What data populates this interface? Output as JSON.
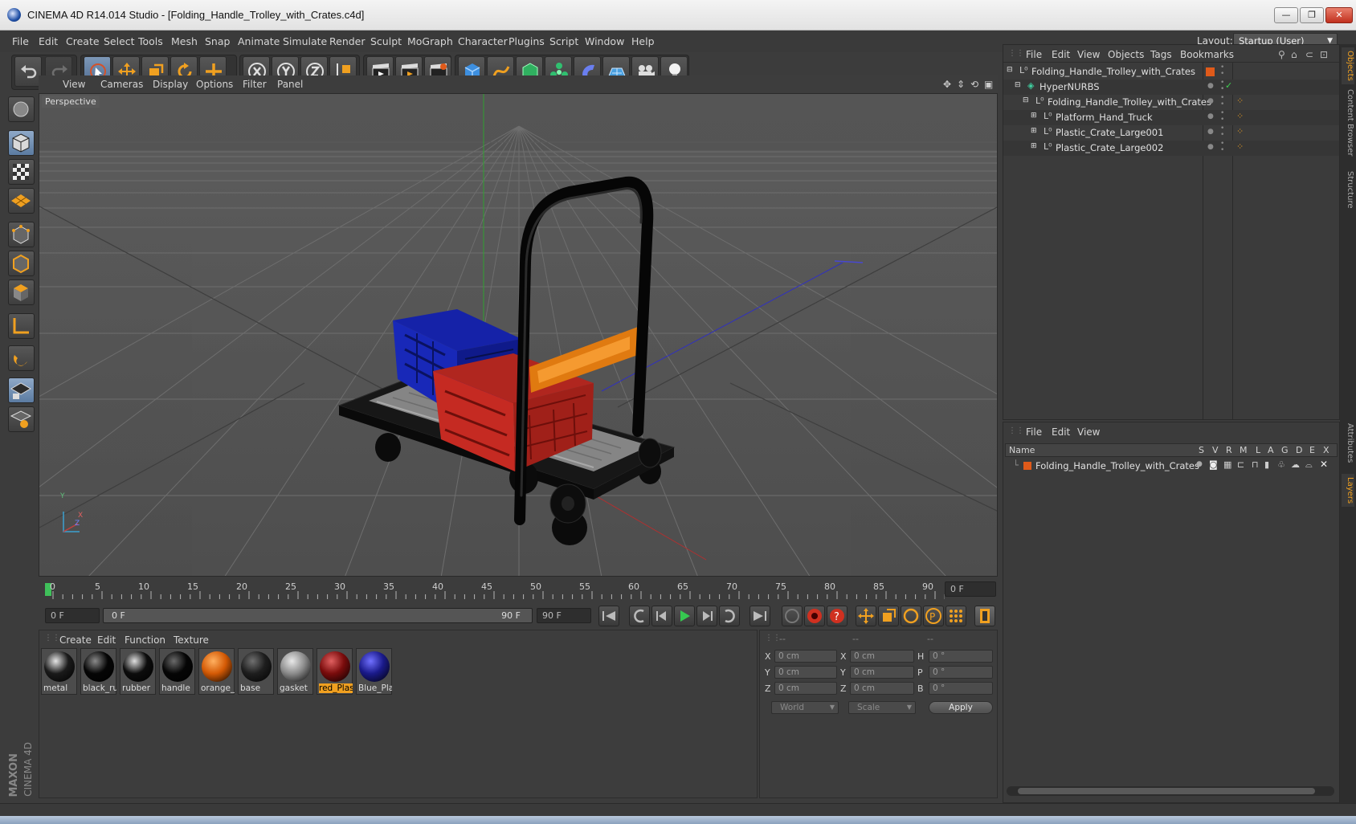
{
  "window": {
    "title": "CINEMA 4D R14.014 Studio - [Folding_Handle_Trolley_with_Crates.c4d]",
    "minimize": "—",
    "restore": "❐",
    "close": "✕"
  },
  "menubar": {
    "items": [
      "File",
      "Edit",
      "Create",
      "Select",
      "Tools",
      "Mesh",
      "Snap",
      "Animate",
      "Simulate",
      "Render",
      "Sculpt",
      "MoGraph",
      "Character",
      "Plugins",
      "Script",
      "Window",
      "Help"
    ],
    "layout_label": "Layout:",
    "layout_value": "Startup (User)"
  },
  "viewport": {
    "menu": [
      "View",
      "Cameras",
      "Display",
      "Options",
      "Filter",
      "Panel"
    ],
    "label": "Perspective",
    "axis_y": "Y",
    "axis_x": "X",
    "axis_z": "Z"
  },
  "timeline": {
    "ticks": [
      "0",
      "5",
      "10",
      "15",
      "20",
      "25",
      "30",
      "35",
      "40",
      "45",
      "50",
      "55",
      "60",
      "65",
      "70",
      "75",
      "80",
      "85",
      "90"
    ],
    "current_frame": "0 F"
  },
  "transport": {
    "start_field": "0 F",
    "range_start": "0 F",
    "range_end": "90 F",
    "end_field": "90 F"
  },
  "materials": {
    "menu": [
      "Create",
      "Edit",
      "Function",
      "Texture"
    ],
    "items": [
      {
        "label": "metal",
        "color": "#1a1a1a",
        "hi": "#e6e6e6"
      },
      {
        "label": "black_ru",
        "color": "#050505",
        "hi": "#8a8a8a"
      },
      {
        "label": "rubber",
        "color": "#0c0c0c",
        "hi": "#e0e0e0"
      },
      {
        "label": "handle",
        "color": "#050505",
        "hi": "#6a6a6a"
      },
      {
        "label": "orange_",
        "color": "#d45a05",
        "hi": "#ffb060"
      },
      {
        "label": "base",
        "color": "#1e1e1e",
        "hi": "#707070"
      },
      {
        "label": "gasket",
        "color": "#8c8c8c",
        "hi": "#e8e8e8"
      },
      {
        "label": "red_Plas",
        "color": "#7a0c0c",
        "hi": "#e06060"
      },
      {
        "label": "Blue_Pla",
        "color": "#1a1a8a",
        "hi": "#7070ff"
      }
    ],
    "selected": "red_Plas"
  },
  "coords": {
    "headers": [
      "--",
      "--",
      "--"
    ],
    "rows": [
      {
        "l1": "X",
        "v1": "0 cm",
        "l2": "X",
        "v2": "0 cm",
        "l3": "H",
        "v3": "0 °"
      },
      {
        "l1": "Y",
        "v1": "0 cm",
        "l2": "Y",
        "v2": "0 cm",
        "l3": "P",
        "v3": "0 °"
      },
      {
        "l1": "Z",
        "v1": "0 cm",
        "l2": "Z",
        "v2": "0 cm",
        "l3": "B",
        "v3": "0 °"
      }
    ],
    "mode": "World",
    "scale": "Scale",
    "apply": "Apply"
  },
  "objects": {
    "menu": [
      "File",
      "Edit",
      "View",
      "Objects",
      "Tags",
      "Bookmarks"
    ],
    "tree": [
      {
        "name": "Folding_Handle_Trolley_with_Crates",
        "depth": 0
      },
      {
        "name": "HyperNURBS",
        "depth": 1
      },
      {
        "name": "Folding_Handle_Trolley_with_Crates",
        "depth": 2
      },
      {
        "name": "Platform_Hand_Truck",
        "depth": 3
      },
      {
        "name": "Plastic_Crate_Large001",
        "depth": 3
      },
      {
        "name": "Plastic_Crate_Large002",
        "depth": 3
      }
    ]
  },
  "layers": {
    "menu": [
      "File",
      "Edit",
      "View"
    ],
    "col_name": "Name",
    "cols": [
      "S",
      "V",
      "R",
      "M",
      "L",
      "A",
      "G",
      "D",
      "E",
      "X"
    ],
    "row": "Folding_Handle_Trolley_with_Crates"
  },
  "sidetabs": [
    "Objects",
    "Content Browser",
    "Structure",
    "Attributes",
    "Layers"
  ],
  "brand": {
    "line1": "MAXON",
    "line2": "CINEMA 4D"
  }
}
